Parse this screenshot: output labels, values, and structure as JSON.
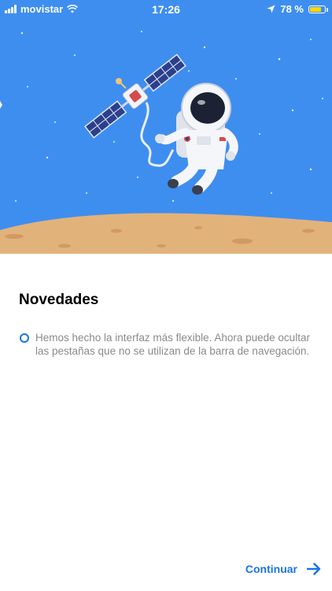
{
  "status_bar": {
    "carrier": "movistar",
    "time": "17:26",
    "battery_text": "78 %",
    "battery_level": 0.78,
    "icons": [
      "signal-icon",
      "wifi-icon",
      "location-arrow-icon",
      "battery-icon"
    ]
  },
  "hero": {
    "illustration": "astronaut-with-satellite-on-moon",
    "colors": {
      "sky": "#3e8ef0",
      "ground": "#e2b27b"
    }
  },
  "main": {
    "title": "Novedades",
    "features": [
      {
        "text": "Hemos hecho la interfaz más flexible. Ahora puede ocultar las pestañas que no se utilizan de la barra de navegación."
      }
    ]
  },
  "footer": {
    "continue_label": "Continuar",
    "accent_color": "#1a73e8"
  }
}
